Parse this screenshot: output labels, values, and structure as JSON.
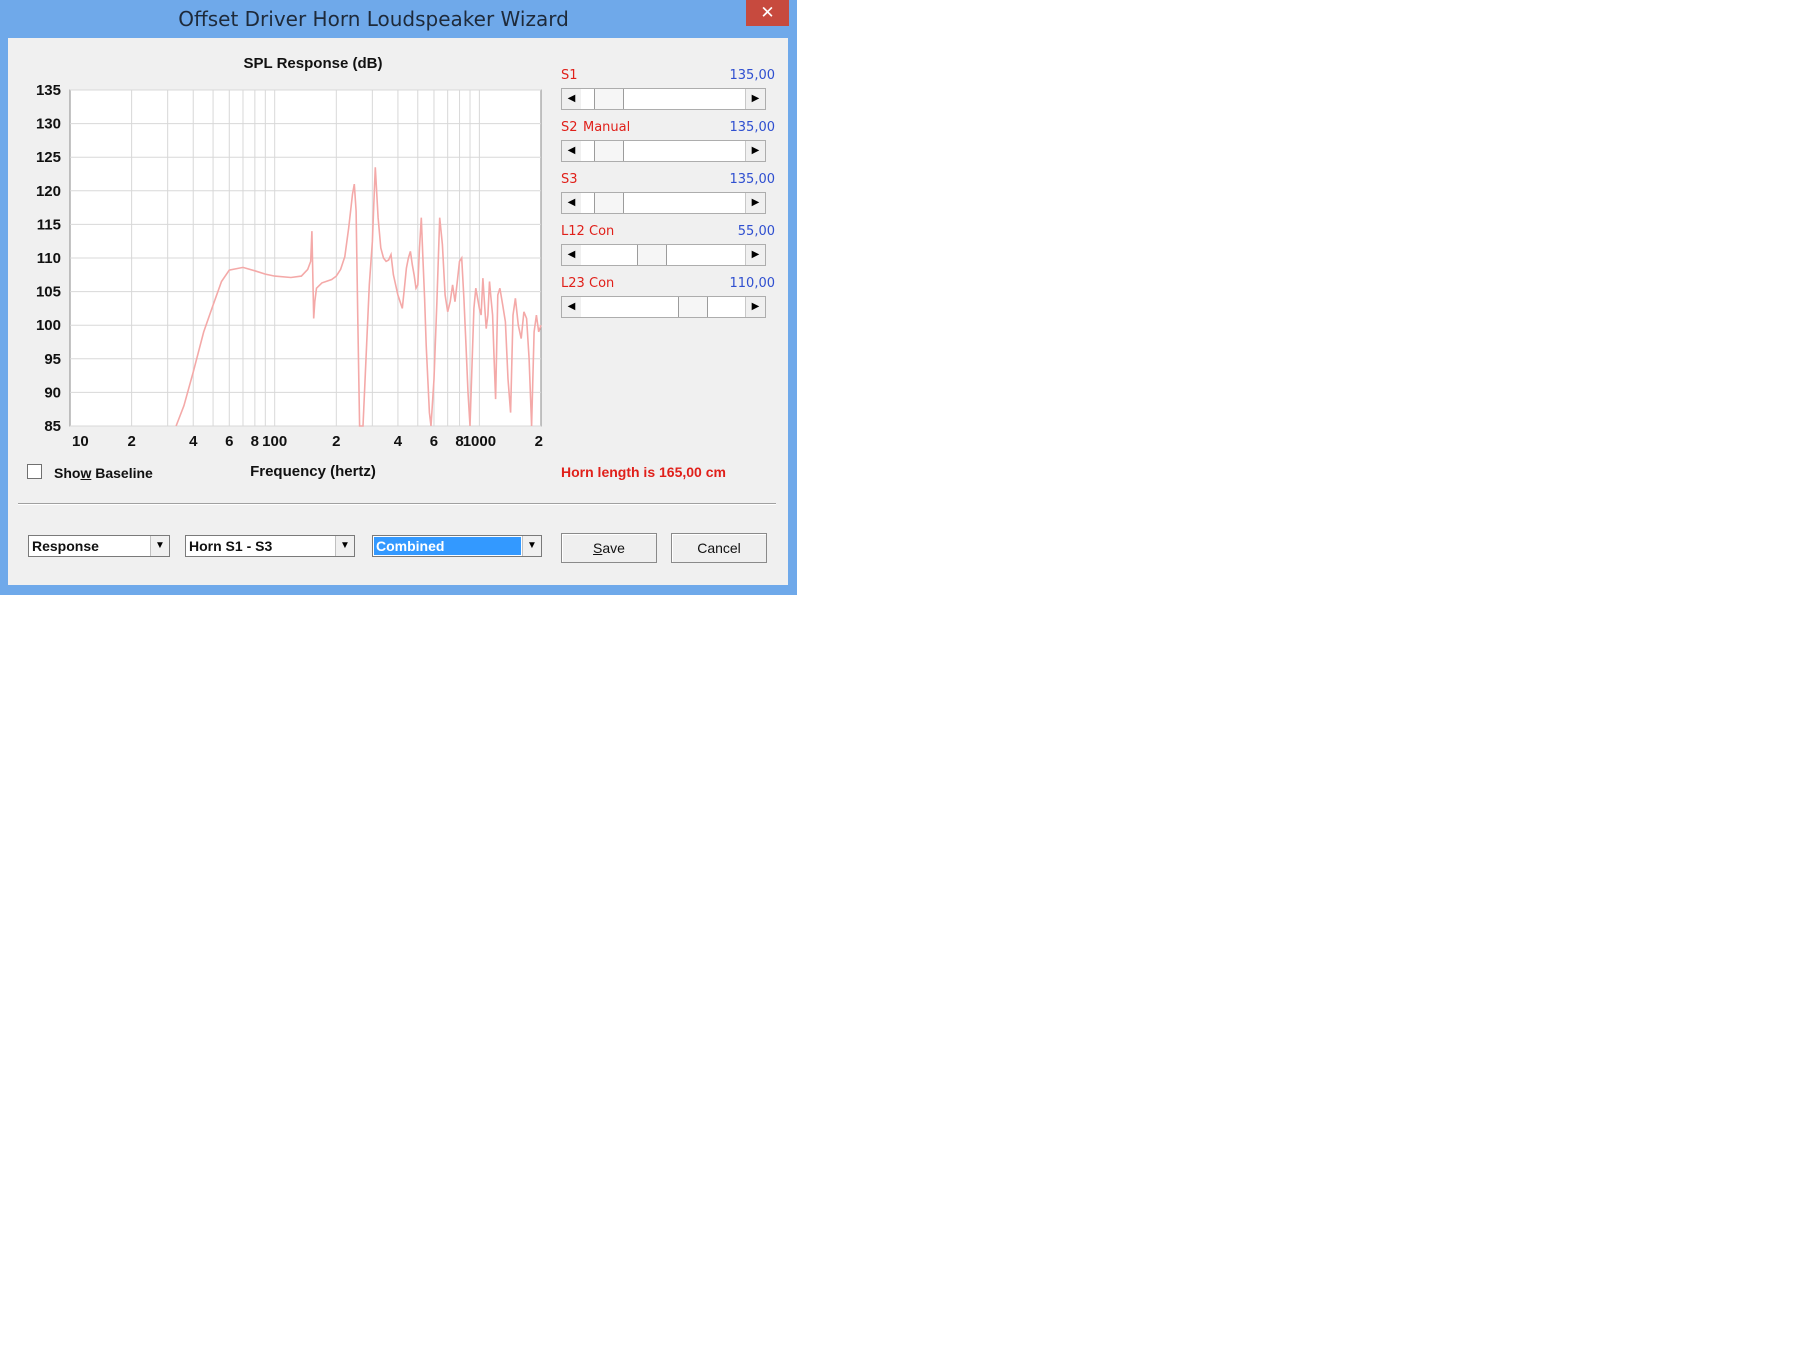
{
  "window": {
    "title": "Offset Driver Horn Loudspeaker Wizard",
    "close_glyph": "✕"
  },
  "chart_data": {
    "type": "line",
    "title": "SPL Response (dB)",
    "xlabel": "Frequency (hertz)",
    "ylabel": "",
    "x_scale": "log",
    "xlim": [
      10,
      2000
    ],
    "ylim": [
      85,
      135
    ],
    "yticks": [
      135,
      130,
      125,
      120,
      115,
      110,
      105,
      100,
      95,
      90,
      85
    ],
    "xtick_labels": [
      {
        "x": 10,
        "label": "10"
      },
      {
        "x": 20,
        "label": "2"
      },
      {
        "x": 40,
        "label": "4"
      },
      {
        "x": 60,
        "label": "6"
      },
      {
        "x": 80,
        "label": "8"
      },
      {
        "x": 100,
        "label": "100"
      },
      {
        "x": 200,
        "label": "2"
      },
      {
        "x": 400,
        "label": "4"
      },
      {
        "x": 600,
        "label": "6"
      },
      {
        "x": 800,
        "label": "8"
      },
      {
        "x": 1000,
        "label": "1000"
      },
      {
        "x": 2000,
        "label": "2"
      }
    ],
    "grid": true,
    "series": [
      {
        "color": "#f4a9a8",
        "x": [
          33,
          36,
          40,
          45,
          50,
          55,
          60,
          70,
          80,
          90,
          100,
          120,
          135,
          145,
          150,
          152,
          155,
          157,
          160,
          170,
          190,
          200,
          210,
          220,
          230,
          240,
          245,
          250,
          255,
          260,
          270,
          290,
          300,
          305,
          310,
          320,
          330,
          340,
          350,
          360,
          370,
          380,
          400,
          420,
          430,
          440,
          450,
          460,
          470,
          480,
          490,
          500,
          510,
          520,
          530,
          540,
          550,
          560,
          570,
          580,
          600,
          620,
          640,
          660,
          680,
          700,
          720,
          740,
          760,
          780,
          800,
          820,
          840,
          860,
          880,
          900,
          920,
          940,
          960,
          980,
          1000,
          1020,
          1040,
          1060,
          1080,
          1100,
          1120,
          1140,
          1160,
          1180,
          1200,
          1230,
          1260,
          1300,
          1340,
          1380,
          1420,
          1460,
          1500,
          1550,
          1600,
          1650,
          1700,
          1750,
          1800,
          1850,
          1900,
          1950,
          2000
        ],
        "y": [
          85,
          88,
          93,
          99,
          103,
          106.5,
          108.2,
          108.6,
          108.1,
          107.6,
          107.3,
          107.1,
          107.3,
          108.3,
          109.5,
          114,
          101,
          103.5,
          105.5,
          106.3,
          106.8,
          107.3,
          108.3,
          110.2,
          114.5,
          119.5,
          121,
          117,
          100,
          85,
          85,
          106,
          112.5,
          118,
          123.5,
          116,
          111.5,
          110,
          109.5,
          109.7,
          110.5,
          107.5,
          104.5,
          102.5,
          105.5,
          108.5,
          110,
          111,
          109,
          107.5,
          105.5,
          106,
          111.5,
          116,
          110,
          104,
          97,
          92,
          87,
          85,
          92,
          103.5,
          116,
          112,
          104.5,
          102,
          103.5,
          106,
          103.5,
          106.5,
          109.5,
          110,
          104,
          97,
          90,
          85,
          94,
          102.5,
          105.5,
          104,
          102.5,
          101.5,
          107,
          103,
          99.5,
          101.5,
          106.5,
          104,
          101.5,
          95,
          89,
          104.5,
          105.5,
          103,
          100.5,
          92,
          87,
          101.5,
          104,
          100,
          98,
          102,
          101,
          95,
          85,
          99,
          101.5,
          99,
          100
        ]
      }
    ]
  },
  "show_baseline": {
    "label_pre": "Sho",
    "label_access": "w",
    "label_post": " Baseline",
    "checked": false
  },
  "sliders": [
    {
      "name": "S1",
      "mode": "",
      "value": "135,00",
      "thumb_frac": 0.08
    },
    {
      "name": "S2",
      "mode": "Manual",
      "value": "135,00",
      "thumb_frac": 0.08
    },
    {
      "name": "S3",
      "mode": "",
      "value": "135,00",
      "thumb_frac": 0.08
    },
    {
      "name": "L12",
      "mode": "Con",
      "value": "55,00",
      "thumb_frac": 0.34
    },
    {
      "name": "L23",
      "mode": "Con",
      "value": "110,00",
      "thumb_frac": 0.59
    }
  ],
  "arrows": {
    "left": "◀",
    "right": "▶",
    "down": "▼"
  },
  "horn_length_text": "Horn length is 165,00 cm",
  "dropdowns": {
    "plot_type": "Response",
    "horn_section": "Horn S1 - S3",
    "driver_mode": "Combined"
  },
  "buttons": {
    "save_pre": "",
    "save_access": "S",
    "save_post": "ave",
    "cancel": "Cancel"
  }
}
